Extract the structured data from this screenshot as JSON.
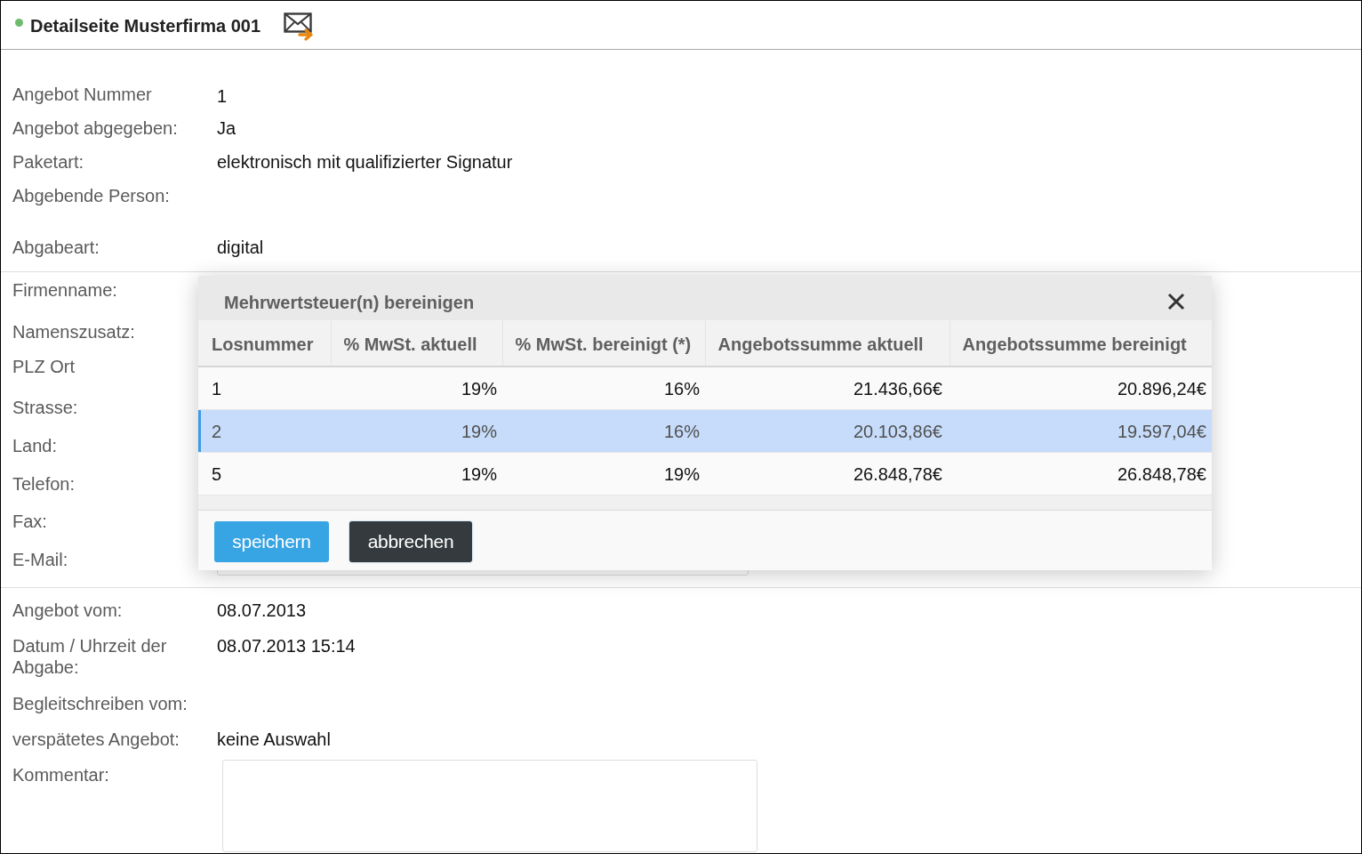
{
  "header": {
    "title": "Detailseite Musterfirma 001"
  },
  "sections": [
    {
      "fields": [
        {
          "label": "Angebot Nummer",
          "kind": "text",
          "value": "1"
        },
        {
          "label": "Angebot abgegeben:",
          "kind": "text",
          "value": "Ja"
        },
        {
          "label": "Paketart:",
          "kind": "text",
          "value": "elektronisch mit qualifizierter Signatur"
        },
        {
          "label": "Abgebende Person:",
          "kind": "text"
        },
        {
          "label": "Abgabeart:",
          "kind": "text",
          "value": "digital"
        }
      ]
    },
    {
      "fields": [
        {
          "label": "Firmenname:",
          "kind": "text"
        },
        {
          "label": "Namenszusatz:",
          "kind": "text"
        },
        {
          "label": "PLZ Ort",
          "kind": "text"
        },
        {
          "label": "Strasse:",
          "kind": "text"
        },
        {
          "label": "Land:",
          "kind": "text"
        },
        {
          "label": "Telefon:",
          "kind": "text"
        },
        {
          "label": "Fax:",
          "kind": "text"
        },
        {
          "label": "E-Mail:",
          "kind": "input"
        }
      ]
    },
    {
      "fields": [
        {
          "label": "Angebot vom:",
          "kind": "text",
          "value": "08.07.2013"
        },
        {
          "label": "Datum / Uhrzeit der Abgabe:",
          "kind": "text",
          "value": "08.07.2013 15:14"
        },
        {
          "label": "Begleitschreiben vom:",
          "kind": "text"
        },
        {
          "label": "verspätetes Angebot:",
          "kind": "text",
          "value": "keine Auswahl"
        },
        {
          "label": "Kommentar:",
          "kind": "textarea"
        }
      ]
    }
  ],
  "dialog": {
    "title": "Mehrwertsteuer(n) bereinigen",
    "table": {
      "columns": [
        "Losnummer",
        "% MwSt. aktuell",
        "% MwSt. bereinigt (*)",
        "Angebotssumme aktuell",
        "Angebotssumme bereinigt"
      ],
      "rows": [
        {
          "cells": [
            "1",
            "19%",
            "16%",
            "21.436,66€",
            "20.896,24€"
          ],
          "selected": false
        },
        {
          "cells": [
            "2",
            "19%",
            "16%",
            "20.103,86€",
            "19.597,04€"
          ],
          "selected": true
        },
        {
          "cells": [
            "5",
            "19%",
            "19%",
            "26.848,78€",
            "26.848,78€"
          ],
          "selected": false
        }
      ]
    },
    "buttons": [
      {
        "label": "speichern",
        "kind": "primary"
      },
      {
        "label": "abbrechen",
        "kind": "secondary"
      }
    ]
  }
}
